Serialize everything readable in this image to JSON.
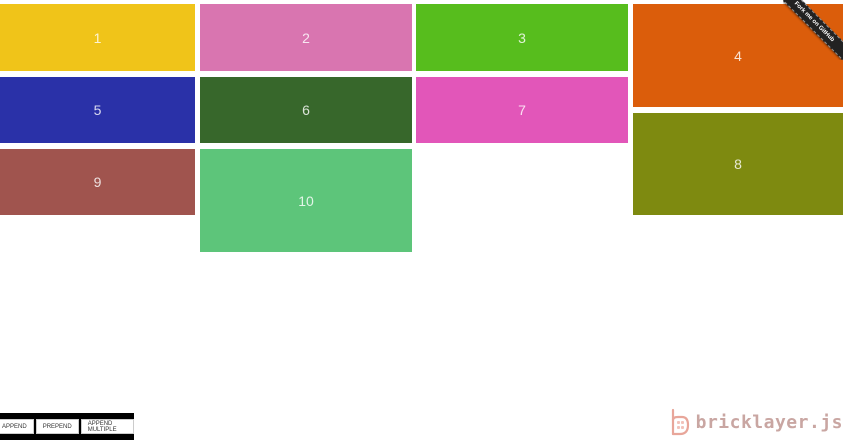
{
  "bricks": [
    {
      "id": "b1",
      "label": "1",
      "color": "#F0C419"
    },
    {
      "id": "b2",
      "label": "2",
      "color": "#D975B0"
    },
    {
      "id": "b3",
      "label": "3",
      "color": "#57BD1D"
    },
    {
      "id": "b4",
      "label": "4",
      "color": "#DB5D0B"
    },
    {
      "id": "b5",
      "label": "5",
      "color": "#2A31A8"
    },
    {
      "id": "b6",
      "label": "6",
      "color": "#37672B"
    },
    {
      "id": "b7",
      "label": "7",
      "color": "#E256B9"
    },
    {
      "id": "b8",
      "label": "8",
      "color": "#7E8A10"
    },
    {
      "id": "b9",
      "label": "9",
      "color": "#A0544E"
    },
    {
      "id": "b10",
      "label": "10",
      "color": "#5DC57A"
    }
  ],
  "ribbon": {
    "label": "Fork me on GitHub"
  },
  "toolbar": {
    "append_label": "APPEND",
    "prepend_label": "PREPEND",
    "append_multiple_label": "APPEND MULTIPLE"
  },
  "logo": {
    "text": "bricklayer.js",
    "color": "#C9A6A2",
    "icon": "bricklayer-logo-icon"
  }
}
